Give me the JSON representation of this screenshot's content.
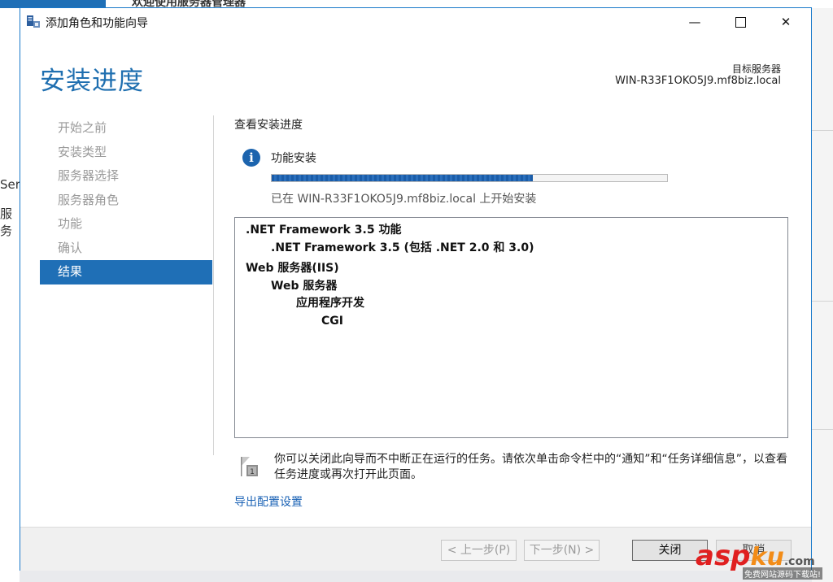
{
  "background": {
    "title": "欢迎使用服务器管理器",
    "left_fragments": [
      "Ser",
      "服务"
    ]
  },
  "window": {
    "title": "添加角色和功能向导",
    "controls": {
      "minimize": "—",
      "close": "✕"
    }
  },
  "header": {
    "page_title": "安装进度",
    "target_label": "目标服务器",
    "target_server": "WIN-R33F1OKO5J9.mf8biz.local"
  },
  "nav": {
    "items": [
      {
        "label": "开始之前"
      },
      {
        "label": "安装类型"
      },
      {
        "label": "服务器选择"
      },
      {
        "label": "服务器角色"
      },
      {
        "label": "功能"
      },
      {
        "label": "确认"
      },
      {
        "label": "结果"
      }
    ],
    "active": "结果"
  },
  "content": {
    "section_title": "查看安装进度",
    "feature_label": "功能安装",
    "progress": 0.66,
    "status_text": "已在 WIN-R33F1OKO5J9.mf8biz.local 上开始安装",
    "results": [
      ".NET Framework 3.5 功能",
      ".NET Framework 3.5 (包括 .NET 2.0 和 3.0)",
      "Web 服务器(IIS)",
      "Web 服务器",
      "应用程序开发",
      "CGI"
    ],
    "note_text": "你可以关闭此向导而不中断正在运行的任务。请依次单击命令栏中的“通知”和“任务详细信息”，以查看任务进度或再次打开此页面。",
    "export_link": "导出配置设置"
  },
  "footer": {
    "prev": "< 上一步(P)",
    "next": "下一步(N) >",
    "close": "关闭",
    "cancel": "取消"
  },
  "watermark": {
    "asp": "asp",
    "ku": "ku",
    "com": ".com",
    "subtitle": "免费网站源码下载站!"
  },
  "colors": {
    "accent": "#1f6fb6",
    "heading": "#1f6fb0",
    "link": "#1a62b5"
  }
}
